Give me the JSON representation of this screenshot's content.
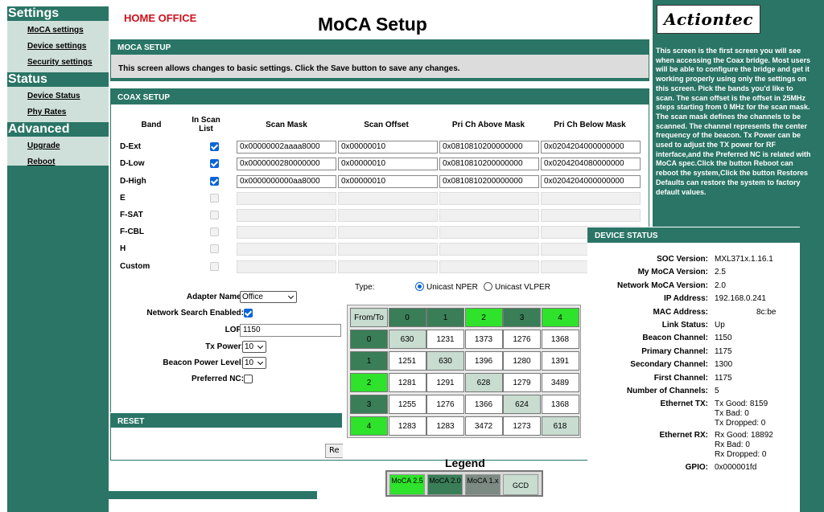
{
  "nav": {
    "settings_title": "Settings",
    "settings_items": [
      "MoCA settings",
      "Device settings",
      "Security settings"
    ],
    "status_title": "Status",
    "status_items": [
      "Device Status",
      "Phy Rates"
    ],
    "advanced_title": "Advanced",
    "advanced_items": [
      "Upgrade",
      "Reboot"
    ]
  },
  "header": {
    "home": "HOME OFFICE",
    "title": "MoCA Setup"
  },
  "moca_setup": {
    "heading": "MOCA SETUP",
    "intro": "This screen allows changes to basic settings. Click the Save button to save any changes."
  },
  "coax": {
    "heading": "COAX SETUP",
    "columns": [
      "Band",
      "In Scan List",
      "Scan Mask",
      "Scan Offset",
      "Pri Ch Above Mask",
      "Pri Ch Below Mask"
    ],
    "rows": [
      {
        "band": "D-Ext",
        "checked": true,
        "mask": "0x00000002aaaa8000",
        "offset": "0x00000010",
        "above": "0x0810810200000000",
        "below": "0x0204204000000000"
      },
      {
        "band": "D-Low",
        "checked": true,
        "mask": "0x0000000280000000",
        "offset": "0x00000010",
        "above": "0x0810810200000000",
        "below": "0x0204204080000000"
      },
      {
        "band": "D-High",
        "checked": true,
        "mask": "0x0000000000aa8000",
        "offset": "0x00000010",
        "above": "0x0810810200000000",
        "below": "0x0204204000000000"
      },
      {
        "band": "E",
        "checked": false,
        "mask": "",
        "offset": "",
        "above": "",
        "below": ""
      },
      {
        "band": "F-SAT",
        "checked": false,
        "mask": "",
        "offset": "",
        "above": "",
        "below": ""
      },
      {
        "band": "F-CBL",
        "checked": false,
        "mask": "",
        "offset": "",
        "above": "",
        "below": ""
      },
      {
        "band": "H",
        "checked": false,
        "mask": "",
        "offset": "",
        "above": "",
        "below": ""
      },
      {
        "band": "Custom",
        "checked": false,
        "mask": "",
        "offset": "",
        "above": "",
        "below": ""
      }
    ]
  },
  "adapter": {
    "name_label": "Adapter Name:",
    "name_value": "Office",
    "search_label": "Network Search Enabled:",
    "search_checked": true,
    "lof_label": "LOF:",
    "lof_value": "1150",
    "txpower_label": "Tx Power:",
    "txpower_value": "10",
    "beacon_label": "Beacon Power Level:",
    "beacon_value": "10",
    "preferred_label": "Preferred NC:",
    "preferred_checked": false
  },
  "reset": {
    "heading": "RESET",
    "button": "Re"
  },
  "type": {
    "label": "Type:",
    "opt1": "Unicast NPER",
    "opt2": "Unicast VLPER",
    "selected": "Unicast NPER"
  },
  "matrix": {
    "corner": "From/To",
    "headers": [
      "0",
      "1",
      "2",
      "3",
      "4"
    ],
    "header_colors": [
      "#3a7e58",
      "#3a7e58",
      "#2fe22b",
      "#3a7e58",
      "#2fe22b"
    ],
    "rows": [
      [
        "630",
        "1231",
        "1373",
        "1276",
        "1368"
      ],
      [
        "1251",
        "630",
        "1396",
        "1280",
        "1391"
      ],
      [
        "1281",
        "1291",
        "628",
        "1279",
        "3489"
      ],
      [
        "1255",
        "1276",
        "1366",
        "624",
        "1368"
      ],
      [
        "1283",
        "1283",
        "3472",
        "1273",
        "618"
      ]
    ]
  },
  "legend": {
    "title": "Legend",
    "items": [
      {
        "label": "MoCA 2.5",
        "color": "#2fe22b"
      },
      {
        "label": "MoCA 2.0",
        "color": "#3a7e58"
      },
      {
        "label": "MoCA 1.x",
        "color": "#7d8a84"
      },
      {
        "label": "GCD",
        "color": "#c8dcd0"
      }
    ]
  },
  "help": {
    "logo": "Actiontec",
    "text": "This screen is the first screen you will see when accessing the Coax bridge. Most users will be able to configure the bridge and get it working properly using only the settings on this screen. Pick the bands you'd like to scan. The scan offset is the offset in 25MHz steps starting from 0 MHz for the scan mask. The scan mask defines the channels to be scanned. The channel represents the center frequency of the beacon. Tx Power can be used to adjust the TX power for RF interface,and the Preferred NC is related with MoCA spec.Click the button Reboot can reboot the system,Click the button Restores Defaults can restore the system to factory default values."
  },
  "device_status": {
    "heading": "DEVICE STATUS",
    "items": [
      {
        "label": "SOC Version:",
        "value": "MXL371x.1.16.1"
      },
      {
        "label": "My MoCA Version:",
        "value": "2.5"
      },
      {
        "label": "Network MoCA Version:",
        "value": "2.0"
      },
      {
        "label": "IP Address:",
        "value": "192.168.0.241"
      },
      {
        "label": "MAC Address:",
        "value": "8c:be"
      },
      {
        "label": "Link Status:",
        "value": "Up"
      },
      {
        "label": "Beacon Channel:",
        "value": "1150"
      },
      {
        "label": "Primary Channel:",
        "value": "1175"
      },
      {
        "label": "Secondary Channel:",
        "value": "1300"
      },
      {
        "label": "First Channel:",
        "value": "1175"
      },
      {
        "label": "Number of Channels:",
        "value": "5"
      }
    ],
    "eth_tx_label": "Ethernet TX:",
    "eth_tx": [
      "Tx Good: 8159",
      "Tx Bad: 0",
      "Tx Dropped: 0"
    ],
    "eth_rx_label": "Ethernet RX:",
    "eth_rx": [
      "Rx Good: 18892",
      "Rx Bad: 0",
      "Rx Dropped: 0"
    ],
    "gpio_label": "GPIO:",
    "gpio_value": "0x000001fd"
  }
}
